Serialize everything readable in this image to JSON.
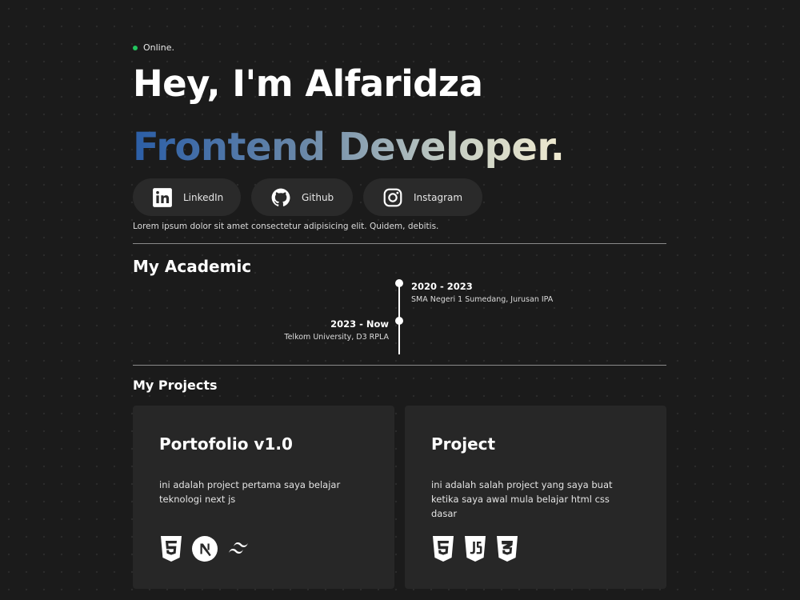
{
  "status": {
    "label": "Online.",
    "color": "#22c55e"
  },
  "hero": {
    "greeting": "Hey, I'm Alfaridza",
    "role": "Frontend Developer."
  },
  "socials": [
    {
      "label": "LinkedIn",
      "icon": "linkedin-icon"
    },
    {
      "label": "Github",
      "icon": "github-icon"
    },
    {
      "label": "Instagram",
      "icon": "instagram-icon"
    }
  ],
  "bio": "Lorem ipsum dolor sit amet consectetur adipisicing elit. Quidem, debitis.",
  "academic": {
    "title": "My Academic",
    "entries": [
      {
        "years": "2020 - 2023",
        "place": "SMA Negeri 1 Sumedang, Jurusan IPA",
        "side": "right"
      },
      {
        "years": "2023 - Now",
        "place": "Telkom University, D3 RPLA",
        "side": "left"
      }
    ]
  },
  "projects": {
    "title": "My Projects",
    "items": [
      {
        "title": "Portofolio v1.0",
        "description": "ini adalah project pertama saya belajar teknologi next js",
        "tech_icons": [
          "html5-icon",
          "nextjs-icon",
          "tailwind-icon"
        ]
      },
      {
        "title": "Project",
        "description": "ini adalah salah project yang saya buat ketika saya awal mula belajar html css dasar",
        "tech_icons": [
          "html5-icon",
          "javascript-icon",
          "css3-icon"
        ]
      }
    ]
  }
}
